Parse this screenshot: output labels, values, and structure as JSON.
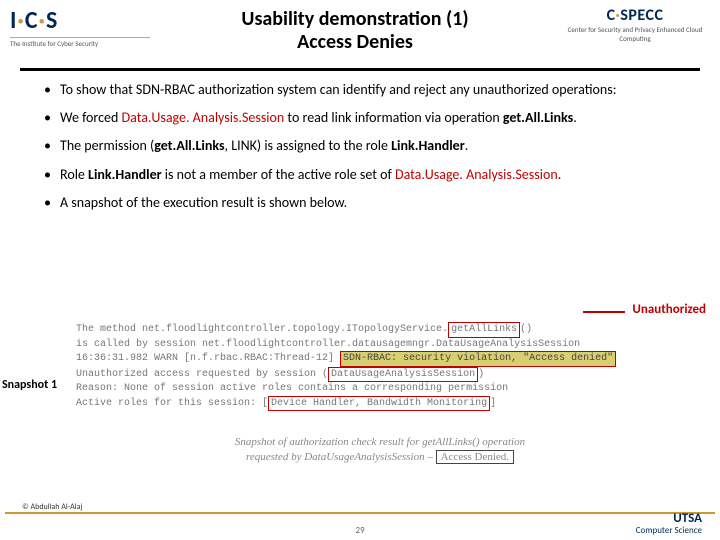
{
  "header": {
    "logo_left_main": "I·C·S",
    "logo_left_tag": "The Institute for Cyber Security",
    "title_l1": "Usability demonstration (1)",
    "title_l2": "Access Denies",
    "logo_right_main": "C·SPECC",
    "logo_right_tag": "Center for Security and Privacy Enhanced Cloud Computing"
  },
  "bullets": {
    "b1": "To show that SDN-RBAC authorization system can identify and reject any unauthorized operations:",
    "b2_a": "We forced ",
    "b2_session": "Data.Usage. Analysis.Session",
    "b2_b": " to read link information via operation ",
    "b2_op": "get.All.Links",
    "b2_c": ".",
    "b3_a": "The permission (",
    "b3_p": "get.All.Links",
    "b3_b": ", LINK) is assigned to the role ",
    "b3_role": "Link.Handler",
    "b3_c": ".",
    "b4_a": "Role ",
    "b4_role": "Link.Handler",
    "b4_b": " is not a member of the active role set of ",
    "b4_sess": "Data.Usage. Analysis.Session",
    "b4_c": ".",
    "b5": "A snapshot of the execution result is shown below."
  },
  "labels": {
    "unauthorized": "Unauthorized",
    "snapshot": "Snapshot 1"
  },
  "console": {
    "l1a": "The method net.floodlightcontroller.topology.ITopologyService.",
    "l1box": "getAllLinks",
    "l1b": "()",
    "l2": "is called by session net.floodlightcontroller.datausagemngr.DataUsageAnalysisSession",
    "l3a": "16:36:31.982 WARN [n.f.rbac.RBAC:Thread-12] ",
    "l3box": "SDN-RBAC: security violation, \"Access denied\"",
    "l4a": "Unauthorized access requested by session (",
    "l4box": "DataUsageAnalysisSession",
    "l4b": ")",
    "l5": "Reason: None of session active roles contains a corresponding permission",
    "l6a": "Active roles for this session: [",
    "l6box": "Device Handler, Bandwidth Monitoring",
    "l6b": "]"
  },
  "caption": {
    "c1": "Snapshot of authorization check result for ",
    "op": "getAllLinks()",
    "c2": " operation",
    "c3": "requested by ",
    "sess": "DataUsageAnalysisSession",
    "c4": " – ",
    "res": "Access Denied."
  },
  "footer": {
    "copyright": "© Abdullah Al-Alaj",
    "utsa1": "UTSA",
    "utsa2": "Computer Science",
    "page": "29"
  }
}
